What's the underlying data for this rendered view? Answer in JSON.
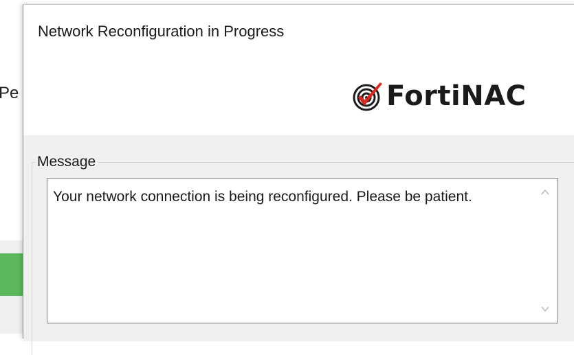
{
  "background_window": {
    "partial_text": "Pe",
    "button_color": "#5cb85c"
  },
  "dialog": {
    "title": "Network Reconfiguration in Progress",
    "logo": {
      "text": "FortiNAC",
      "icon": "fortinac-radar-check-icon",
      "accent_color": "#da291c"
    },
    "message_group": {
      "label": "Message",
      "text": "Your network connection is being reconfigured.  Please be patient."
    },
    "scrollbar": {
      "up_icon": "chevron-up-icon",
      "down_icon": "chevron-down-icon"
    }
  }
}
